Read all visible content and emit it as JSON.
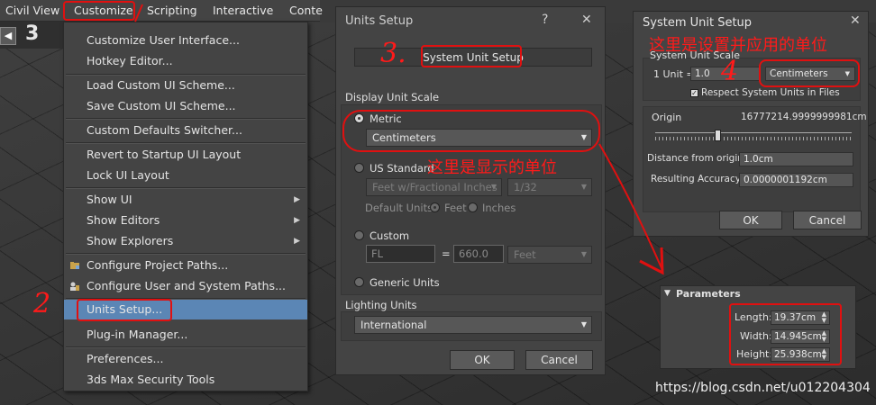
{
  "menubar": {
    "items": [
      {
        "label": "Civil View"
      },
      {
        "label": "Customize"
      },
      {
        "label": "Scripting"
      },
      {
        "label": "Interactive"
      },
      {
        "label": "Conte"
      }
    ]
  },
  "toolbar": {
    "digit": "3"
  },
  "customize_menu": {
    "items": [
      {
        "label": "Customize User Interface..."
      },
      {
        "label": "Hotkey Editor..."
      },
      {
        "label": "Load Custom UI Scheme..."
      },
      {
        "label": "Save Custom UI Scheme..."
      },
      {
        "label": "Custom Defaults Switcher..."
      },
      {
        "label": "Revert to Startup UI Layout"
      },
      {
        "label": "Lock UI Layout"
      },
      {
        "label": "Show UI"
      },
      {
        "label": "Show Editors"
      },
      {
        "label": "Show Explorers"
      },
      {
        "label": "Configure Project Paths..."
      },
      {
        "label": "Configure User and System Paths..."
      },
      {
        "label": "Units Setup..."
      },
      {
        "label": "Plug-in Manager..."
      },
      {
        "label": "Preferences..."
      },
      {
        "label": "3ds Max Security Tools"
      }
    ]
  },
  "units_setup": {
    "title": "Units Setup",
    "help": "?",
    "close": "✕",
    "system_unit_button": "System Unit Setup",
    "display_unit_scale_label": "Display Unit Scale",
    "metric_label": "Metric",
    "metric_value": "Centimeters",
    "us_standard_label": "US Standard",
    "us_value": "Feet w/Fractional Inches",
    "us_fraction": "1/32",
    "default_units_label": "Default Units:",
    "feet_label": "Feet",
    "inches_label": "Inches",
    "custom_label": "Custom",
    "custom_name": "FL",
    "equals": "=",
    "custom_value": "660.0",
    "custom_unit": "Feet",
    "generic_label": "Generic Units",
    "lighting_units_label": "Lighting Units",
    "lighting_value": "International",
    "ok": "OK",
    "cancel": "Cancel"
  },
  "system_unit_setup": {
    "title": "System Unit Setup",
    "close": "✕",
    "scale_label": "System Unit Scale",
    "unit_prefix": "1 Unit =",
    "unit_value": "1.0",
    "unit_type": "Centimeters",
    "respect_label": "Respect System Units in Files",
    "origin_label": "Origin",
    "origin_value": "16777214.9999999981cm",
    "distance_label": "Distance from origin:",
    "distance_value": "1.0cm",
    "accuracy_label": "Resulting Accuracy:",
    "accuracy_value": "0.0000001192cm",
    "ok": "OK",
    "cancel": "Cancel"
  },
  "parameters": {
    "title": "Parameters",
    "length_label": "Length:",
    "length_value": "19.37cm",
    "width_label": "Width:",
    "width_value": "14.945cm",
    "height_label": "Height:",
    "height_value": "25.938cm"
  },
  "annotations": {
    "step2": "2",
    "step3": "3.",
    "step4": "4",
    "display_note": "这里是显示的单位",
    "system_note": "这里是设置并应用的单位"
  },
  "watermark": "https://blog.csdn.net/u012204304",
  "colors": {
    "annotation": "#e01010",
    "highlight": "#5b86b5"
  }
}
